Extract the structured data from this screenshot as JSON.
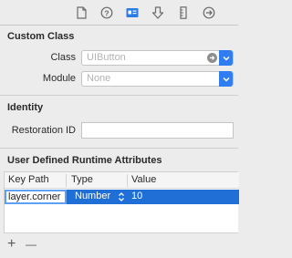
{
  "custom_class": {
    "title": "Custom Class",
    "class_label": "Class",
    "class_placeholder": "UIButton",
    "module_label": "Module",
    "module_placeholder": "None"
  },
  "identity": {
    "title": "Identity",
    "restoration_label": "Restoration ID",
    "restoration_value": ""
  },
  "runtime_attributes": {
    "title": "User Defined Runtime Attributes",
    "columns": [
      "Key Path",
      "Type",
      "Value"
    ],
    "rows": [
      {
        "key_path": "layer.corner",
        "type": "Number",
        "value": "10"
      }
    ]
  },
  "bottom_bar": {
    "add": "+",
    "remove": "—"
  },
  "colors": {
    "accent": "#2f7df0",
    "selection": "#1f6fd6"
  },
  "toolbar_icons": [
    "file-icon",
    "help-icon",
    "identity-inspector-icon",
    "attributes-inspector-icon",
    "size-inspector-icon",
    "connections-inspector-icon"
  ]
}
